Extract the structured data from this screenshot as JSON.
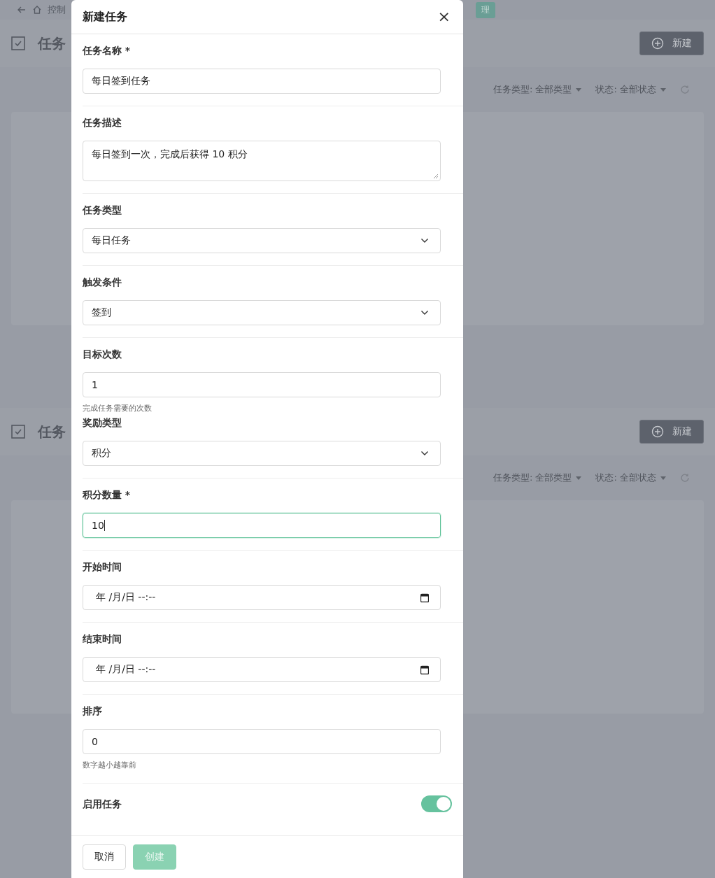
{
  "background": {
    "breadcrumb": "控制",
    "badge": "理",
    "sections": [
      {
        "title": "任务",
        "new_button": "新建",
        "filters": [
          {
            "label": "任务类型:",
            "value": "全部类型"
          },
          {
            "label": "状态:",
            "value": "全部状态"
          }
        ]
      },
      {
        "title": "任务",
        "new_button": "新建",
        "filters": [
          {
            "label": "任务类型:",
            "value": "全部类型"
          },
          {
            "label": "状态:",
            "value": "全部状态"
          }
        ]
      }
    ]
  },
  "modal": {
    "title": "新建任务",
    "close": "×",
    "groups": [
      {
        "fields": [
          {
            "kind": "text",
            "label": "任务名称 *",
            "value": "每日签到任务",
            "focused": false
          }
        ]
      },
      {
        "fields": [
          {
            "kind": "textarea",
            "label": "任务描述",
            "value": "每日签到一次，完成后获得 10 积分",
            "focused": false
          }
        ]
      },
      {
        "fields": [
          {
            "kind": "select",
            "label": "任务类型",
            "value": "每日任务",
            "focused": false
          }
        ]
      },
      {
        "fields": [
          {
            "kind": "select",
            "label": "触发条件",
            "value": "签到",
            "focused": false
          }
        ]
      },
      {
        "fields": [
          {
            "kind": "text",
            "label": "目标次数",
            "value": "1",
            "hint": "完成任务需要的次数",
            "focused": false
          },
          {
            "kind": "select",
            "label": "奖励类型",
            "value": "积分",
            "focused": false
          }
        ]
      },
      {
        "fields": [
          {
            "kind": "text",
            "label": "积分数量 *",
            "value": "10",
            "focused": true
          }
        ]
      },
      {
        "fields": [
          {
            "kind": "datetime",
            "label": "开始时间",
            "value": "年 /月/日 --:--",
            "focused": false
          }
        ]
      },
      {
        "fields": [
          {
            "kind": "datetime",
            "label": "结束时间",
            "value": "年 /月/日 --:--",
            "focused": false
          }
        ]
      },
      {
        "fields": [
          {
            "kind": "text",
            "label": "排序",
            "value": "0",
            "hint": "数字越小越靠前",
            "focused": false
          }
        ]
      },
      {
        "fields": [
          {
            "kind": "toggle",
            "label": "启用任务",
            "on": true
          }
        ]
      }
    ],
    "buttons": [
      {
        "kind": "cancel",
        "label": "取消",
        "disabled": false
      },
      {
        "kind": "primary",
        "label": "创建",
        "disabled": true
      }
    ]
  }
}
